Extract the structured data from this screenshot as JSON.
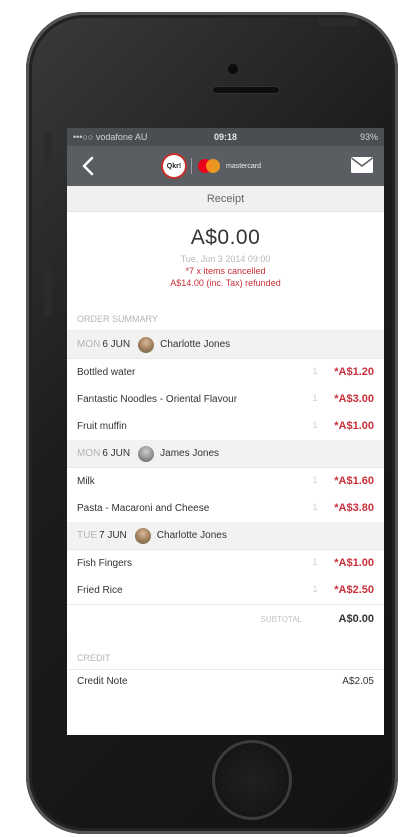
{
  "status_bar": {
    "carrier": "•••○○ vodafone AU",
    "time": "09:18",
    "battery": "93%"
  },
  "nav": {
    "qkr_label": "Qkr!",
    "mc_label": "mastercard"
  },
  "subheader": "Receipt",
  "receipt": {
    "amount": "A$0.00",
    "date": "Tue, Jun 3 2014 09:00",
    "cancelled": "*7 x items cancelled",
    "refunded": "A$14.00 (inc. Tax) refunded"
  },
  "order_summary_label": "ORDER SUMMARY",
  "days": [
    {
      "dow": "MON",
      "date": "6 JUN",
      "person": "Charlotte Jones",
      "items": [
        {
          "name": "Bottled water",
          "qty": "1",
          "price": "*A$1.20"
        },
        {
          "name": "Fantastic Noodles - Oriental Flavour",
          "qty": "1",
          "price": "*A$3.00"
        },
        {
          "name": "Fruit muffin",
          "qty": "1",
          "price": "*A$1.00"
        }
      ]
    },
    {
      "dow": "MON",
      "date": "6 JUN",
      "person": "James Jones",
      "items": [
        {
          "name": "Milk",
          "qty": "1",
          "price": "*A$1.60"
        },
        {
          "name": "Pasta - Macaroni and Cheese",
          "qty": "1",
          "price": "*A$3.80"
        }
      ]
    },
    {
      "dow": "TUE",
      "date": "7 JUN",
      "person": "Charlotte Jones",
      "items": [
        {
          "name": "Fish Fingers",
          "qty": "1",
          "price": "*A$1.00"
        },
        {
          "name": "Fried Rice",
          "qty": "1",
          "price": "*A$2.50"
        }
      ]
    }
  ],
  "subtotal": {
    "label": "SUBTOTAL",
    "value": "A$0.00"
  },
  "credit_label": "CREDIT",
  "credit_item": {
    "name": "Credit Note",
    "value": "A$2.05"
  },
  "colors": {
    "accent_red": "#c8303a",
    "navbar": "#5a5e63"
  }
}
